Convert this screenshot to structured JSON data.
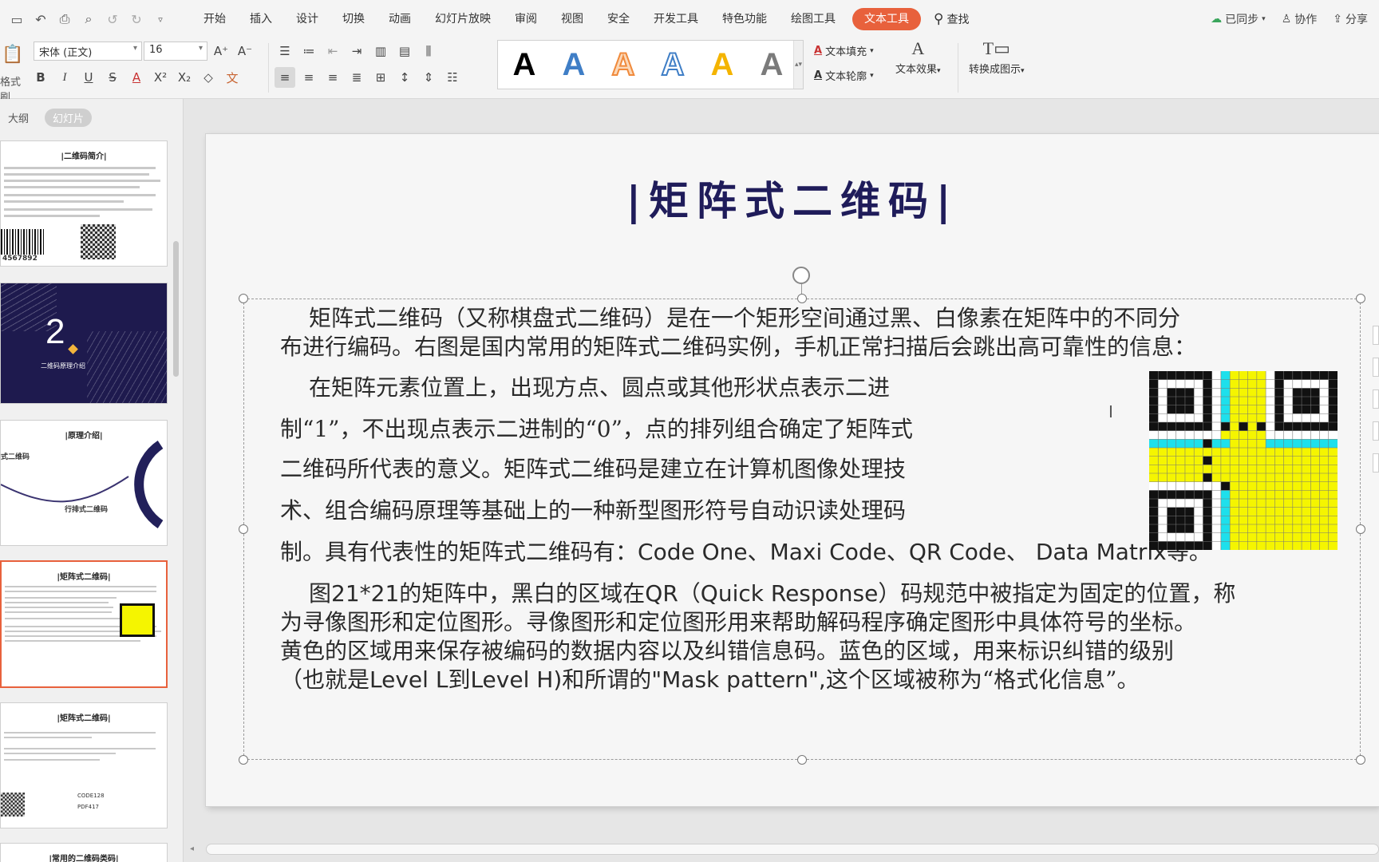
{
  "menubar": {
    "quick_icons": [
      "save-icon",
      "undo-history-icon",
      "print-icon",
      "print-preview-icon",
      "undo-icon",
      "redo-icon",
      "customize-icon"
    ],
    "menus": [
      "开始",
      "插入",
      "设计",
      "切换",
      "动画",
      "幻灯片放映",
      "审阅",
      "视图",
      "安全",
      "开发工具",
      "特色功能",
      "绘图工具"
    ],
    "active_menu": "文本工具",
    "search_label": "查找",
    "sync_label": "已同步",
    "collab_label": "协作",
    "share_label": "分享"
  },
  "ribbon": {
    "format_painter_label": "格式刷",
    "font_name": "宋体 (正文)",
    "font_size": "16",
    "text_styles": [
      {
        "glyph": "A",
        "color": "#000000",
        "style": "solid"
      },
      {
        "glyph": "A",
        "color": "#3f7ec6",
        "style": "solid"
      },
      {
        "glyph": "A",
        "color": "#f08a3c",
        "style": "outline"
      },
      {
        "glyph": "A",
        "color": "#3f7ec6",
        "style": "outline"
      },
      {
        "glyph": "A",
        "color": "#f4b400",
        "style": "solid"
      },
      {
        "glyph": "A",
        "color": "#7b7b7b",
        "style": "solid"
      }
    ],
    "text_fill_label": "文本填充",
    "text_outline_label": "文本轮廓",
    "text_effect_label": "文本效果",
    "convert_label": "转换成图示"
  },
  "leftpanel": {
    "tab_outline": "大纲",
    "tab_slides": "幻灯片",
    "thumbs": [
      {
        "title": "|二维码简介|",
        "barcode_digits": "4567892"
      },
      {
        "number": "2",
        "subtitle": "二维码原理介绍"
      },
      {
        "title": "|原理介绍|",
        "left_label": "式二维码",
        "right_label": "行排式二维码"
      },
      {
        "title": "|矩阵式二维码|"
      },
      {
        "title": "|矩阵式二维码|",
        "labels": [
          "CODE128",
          "PDF417"
        ]
      },
      {
        "title": "|常用的二维码类码|"
      }
    ]
  },
  "slide": {
    "title": "|矩阵式二维码|",
    "p1_line1": "矩阵式二维码（又称棋盘式二维码）是在一个矩形空间通过黑、白像素在矩阵中的不同分",
    "p1_line2": "布进行编码。右图是国内常用的矩阵式二维码实例，手机正常扫描后会跳出高可靠性的信息：",
    "p2_line1": "在矩阵元素位置上，出现方点、圆点或其他形状点表示二进",
    "p2_line2": "制“1”，不出现点表示二进制的“0”，点的排列组合确定了矩阵式",
    "p2_line3": "二维码所代表的意义。矩阵式二维码是建立在计算机图像处理技",
    "p2_line4": "术、组合编码原理等基础上的一种新型图形符号自动识读处理码",
    "p2_line5_a": "制。具有代表性的矩阵式二维码有：",
    "p2_line5_b": "Code One、Maxi Code、QR Code、 Data Matrix",
    "p2_line5_c": "等。",
    "p3_line1_a": "图",
    "p3_line1_b": "21*21",
    "p3_line1_c": "的矩阵中，黑白的区域在",
    "p3_line1_d": "QR（Quick Response）",
    "p3_line1_e": "码规范中被指定为固定的位置，称",
    "p3_line2": "为寻像图形和定位图形。寻像图形和定位图形用来帮助解码程序确定图形中具体符号的坐标。",
    "p3_line3": "黄色的区域用来保存被编码的数据内容以及纠错信息码。蓝色的区域，用来标识纠错的级别",
    "p3_line4_a": "（也就是",
    "p3_line4_b": "Level L",
    "p3_line4_c": "到",
    "p3_line4_d": "Level H)",
    "p3_line4_e": "和所谓的",
    "p3_line4_f": "\"Mask pattern\",",
    "p3_line4_g": "这个区域被称为“格式化信息”。",
    "qr_colors": {
      "dark": "#111111",
      "yellow": "#f5f500",
      "cyan": "#1ee0ec",
      "white": "#ffffff"
    }
  },
  "colors": {
    "accent": "#e8613c",
    "title": "#1f1c5a"
  }
}
